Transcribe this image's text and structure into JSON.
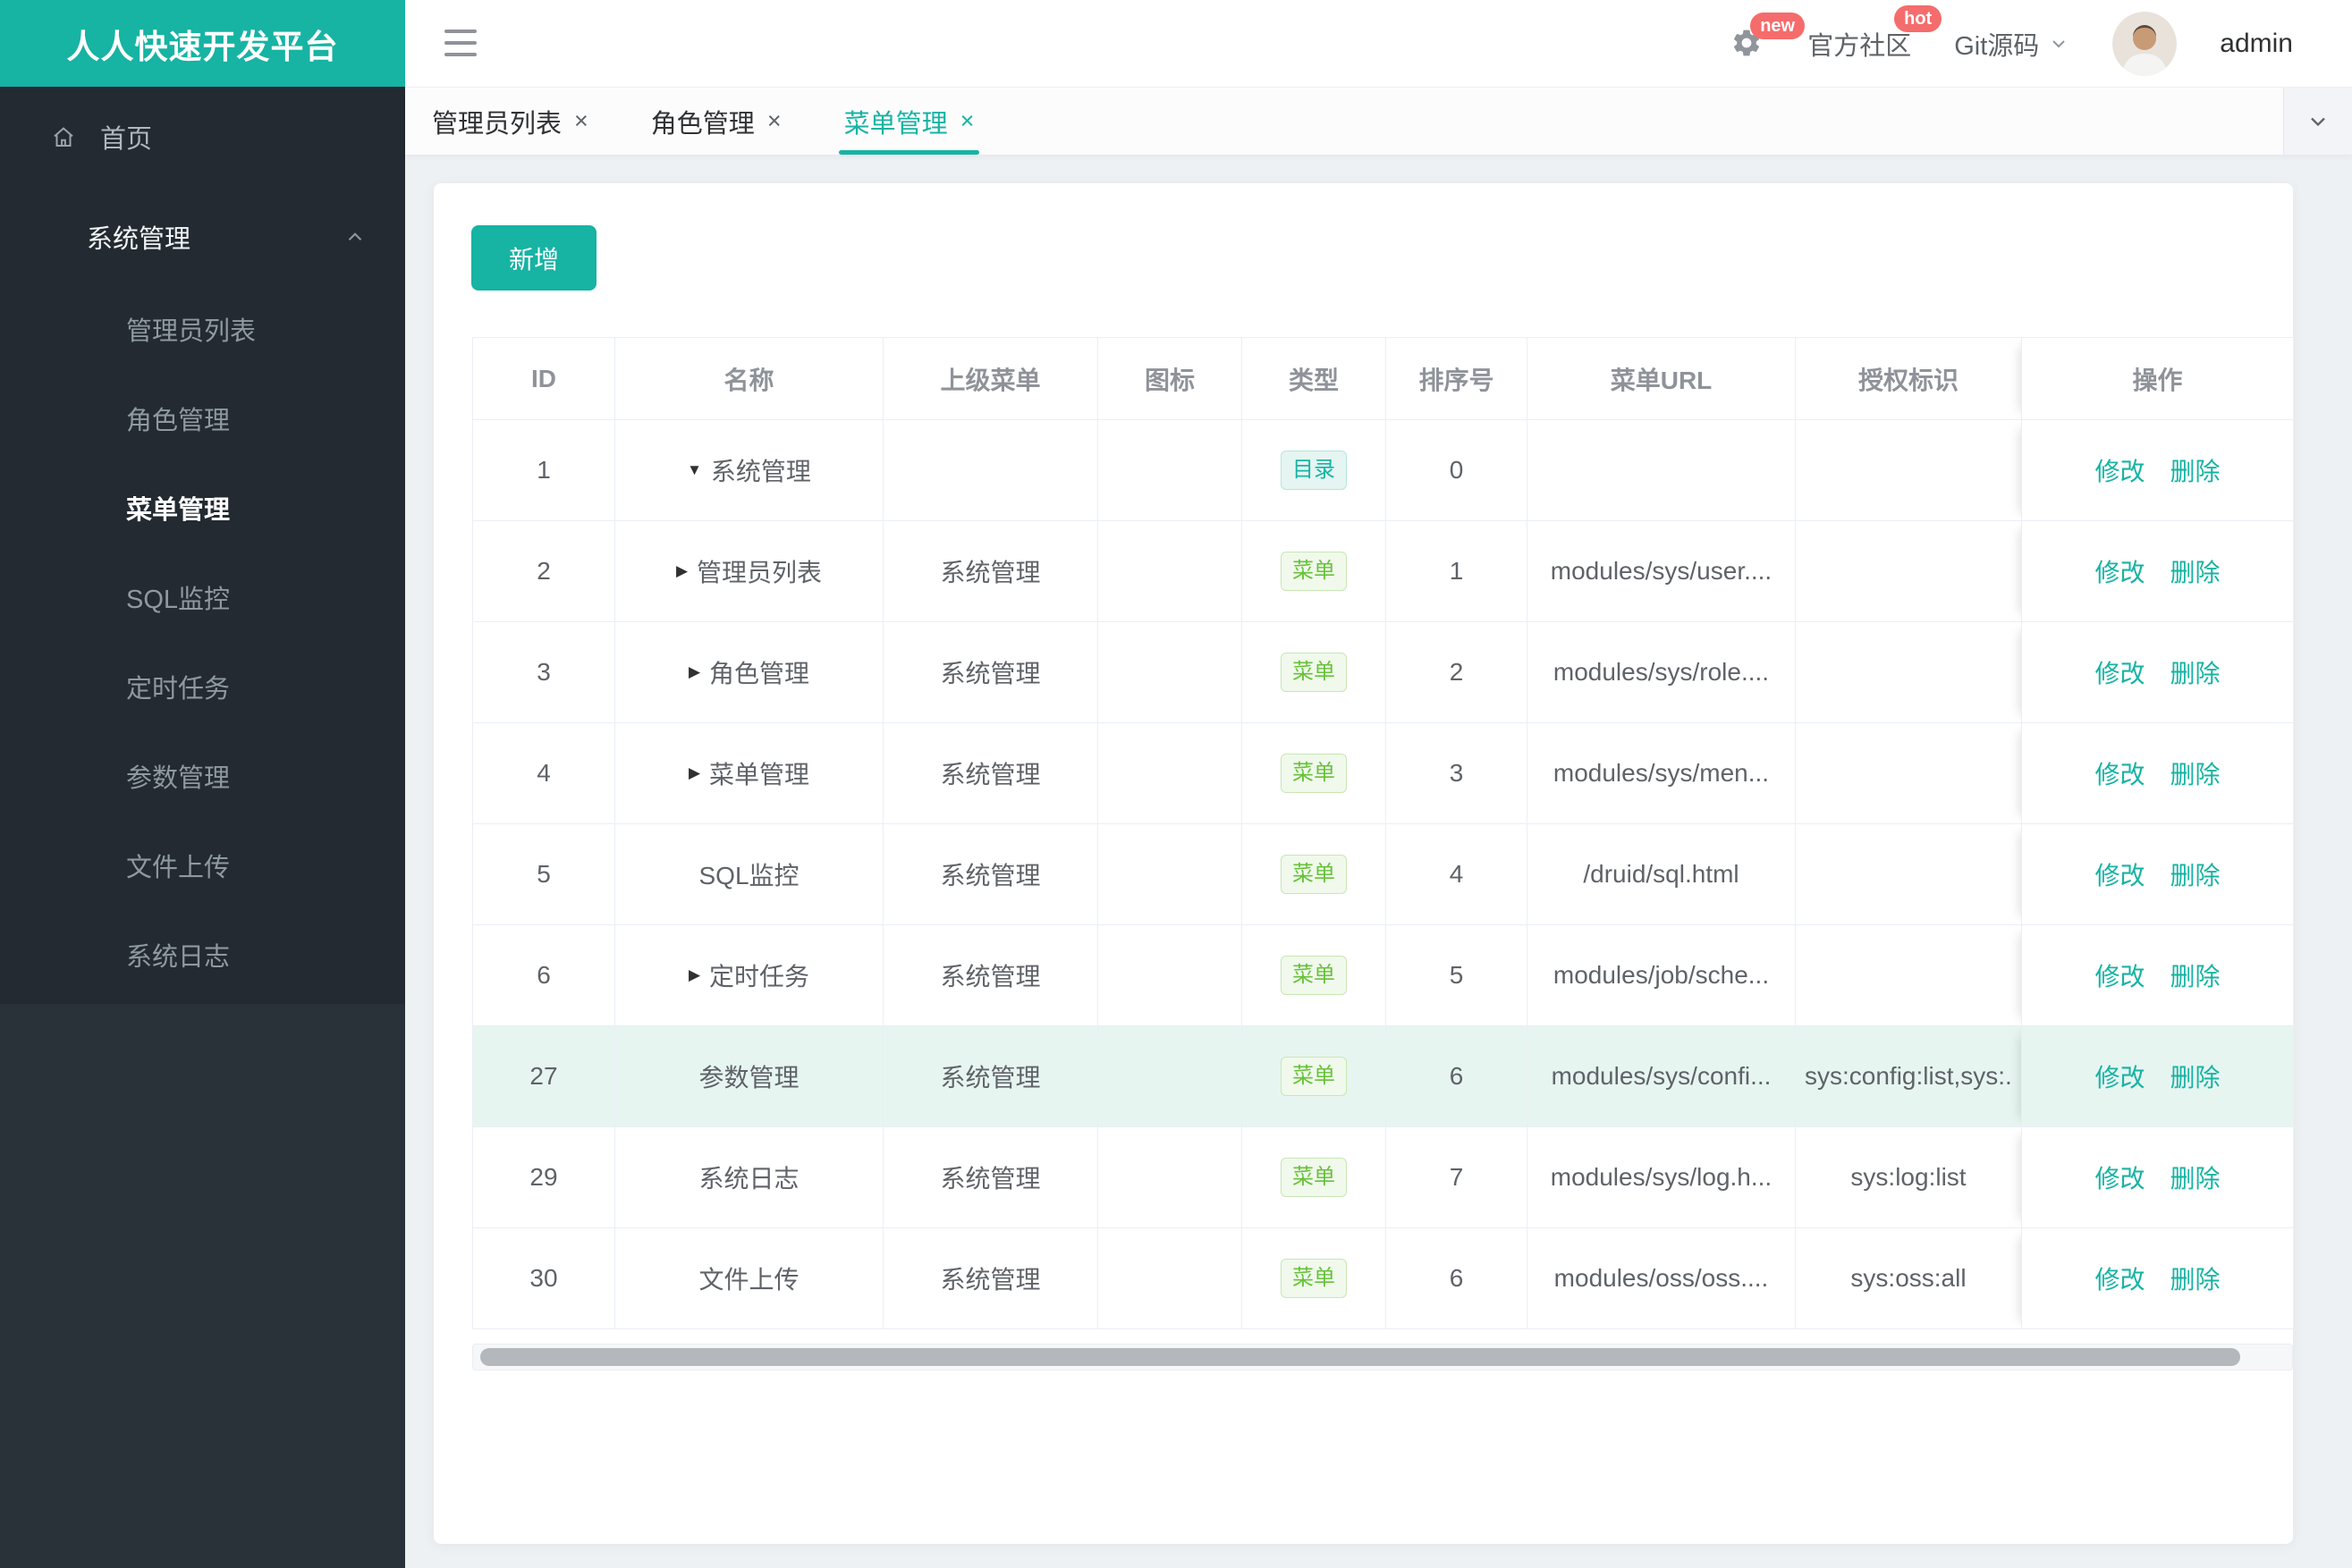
{
  "app": {
    "logo_title": "人人快速开发平台"
  },
  "topbar": {
    "community_label": "官方社区",
    "git_label": "Git源码",
    "username": "admin",
    "badge_new": "new",
    "badge_hot": "hot"
  },
  "sidebar": {
    "home_label": "首页",
    "group_title": "系统管理",
    "items": [
      {
        "label": "管理员列表",
        "active": false
      },
      {
        "label": "角色管理",
        "active": false
      },
      {
        "label": "菜单管理",
        "active": true
      },
      {
        "label": "SQL监控",
        "active": false
      },
      {
        "label": "定时任务",
        "active": false
      },
      {
        "label": "参数管理",
        "active": false
      },
      {
        "label": "文件上传",
        "active": false
      },
      {
        "label": "系统日志",
        "active": false
      }
    ]
  },
  "tabs": [
    {
      "label": "管理员列表",
      "active": false
    },
    {
      "label": "角色管理",
      "active": false
    },
    {
      "label": "菜单管理",
      "active": true
    }
  ],
  "toolbar": {
    "add_label": "新增"
  },
  "table": {
    "columns": [
      "ID",
      "名称",
      "上级菜单",
      "图标",
      "类型",
      "排序号",
      "菜单URL",
      "授权标识",
      "操作"
    ],
    "edit_label": "修改",
    "delete_label": "删除",
    "rows": [
      {
        "id": "1",
        "arrow": "▼",
        "name": "系统管理",
        "parent": "",
        "icon": "",
        "type": "目录",
        "type_kind": "dir",
        "order": "0",
        "url": "",
        "perms": "",
        "highlight": false
      },
      {
        "id": "2",
        "arrow": "▶",
        "name": "管理员列表",
        "parent": "系统管理",
        "icon": "",
        "type": "菜单",
        "type_kind": "menu",
        "order": "1",
        "url": "modules/sys/user....",
        "perms": "",
        "highlight": false
      },
      {
        "id": "3",
        "arrow": "▶",
        "name": "角色管理",
        "parent": "系统管理",
        "icon": "",
        "type": "菜单",
        "type_kind": "menu",
        "order": "2",
        "url": "modules/sys/role....",
        "perms": "",
        "highlight": false
      },
      {
        "id": "4",
        "arrow": "▶",
        "name": "菜单管理",
        "parent": "系统管理",
        "icon": "",
        "type": "菜单",
        "type_kind": "menu",
        "order": "3",
        "url": "modules/sys/men...",
        "perms": "",
        "highlight": false
      },
      {
        "id": "5",
        "arrow": "",
        "name": "SQL监控",
        "parent": "系统管理",
        "icon": "",
        "type": "菜单",
        "type_kind": "menu",
        "order": "4",
        "url": "/druid/sql.html",
        "perms": "",
        "highlight": false
      },
      {
        "id": "6",
        "arrow": "▶",
        "name": "定时任务",
        "parent": "系统管理",
        "icon": "",
        "type": "菜单",
        "type_kind": "menu",
        "order": "5",
        "url": "modules/job/sche...",
        "perms": "",
        "highlight": false
      },
      {
        "id": "27",
        "arrow": "",
        "name": "参数管理",
        "parent": "系统管理",
        "icon": "",
        "type": "菜单",
        "type_kind": "menu",
        "order": "6",
        "url": "modules/sys/confi...",
        "perms": "sys:config:list,sys:...",
        "highlight": true
      },
      {
        "id": "29",
        "arrow": "",
        "name": "系统日志",
        "parent": "系统管理",
        "icon": "",
        "type": "菜单",
        "type_kind": "menu",
        "order": "7",
        "url": "modules/sys/log.h...",
        "perms": "sys:log:list",
        "highlight": false
      },
      {
        "id": "30",
        "arrow": "",
        "name": "文件上传",
        "parent": "系统管理",
        "icon": "",
        "type": "菜单",
        "type_kind": "menu",
        "order": "6",
        "url": "modules/oss/oss....",
        "perms": "sys:oss:all",
        "highlight": false
      }
    ]
  },
  "colors": {
    "primary": "#17b3a3",
    "sidebar_bg": "#293239",
    "menu_bg": "#232a31",
    "danger_badge": "#f56c6c",
    "success_tag": "#67c23a",
    "highlight_row": "#e7f5f1"
  }
}
